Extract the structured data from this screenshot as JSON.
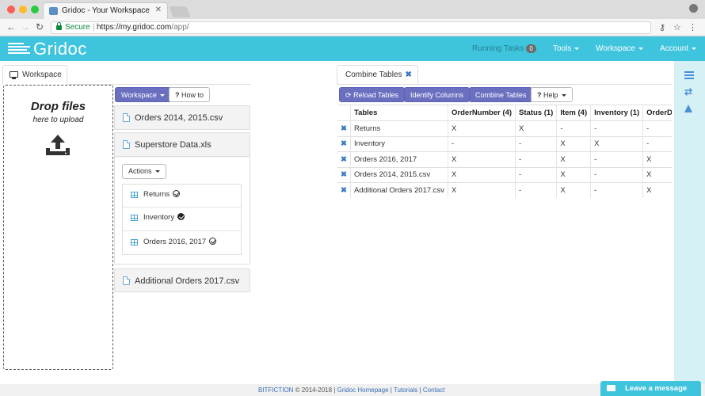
{
  "browser": {
    "tab_title": "Gridoc - Your Workspace",
    "secure_label": "Secure",
    "url_host": "https://my.gridoc.com",
    "url_path": "/app/"
  },
  "navbar": {
    "logo": "Gridoc",
    "running_tasks_label": "Running Tasks",
    "running_tasks_count": "0",
    "tools": "Tools",
    "workspace": "Workspace",
    "account": "Account",
    "color": "#3fc4de"
  },
  "left_panel": {
    "tab_label": "Workspace",
    "drop_title": "Drop files",
    "drop_subtitle": "here to upload",
    "workspace_button": "Workspace",
    "howto_button": "How to",
    "files": [
      {
        "name": "Orders 2014, 2015.csv"
      },
      {
        "name": "Superstore Data.xls"
      },
      {
        "name": "Additional Orders 2017.csv"
      }
    ],
    "actions_button": "Actions",
    "sheets": [
      {
        "label": "Returns",
        "icon": "check-circle-outline"
      },
      {
        "label": "Inventory",
        "icon": "check-circle-solid"
      },
      {
        "label": "Orders 2016, 2017",
        "icon": "check-circle-outline"
      }
    ]
  },
  "combine": {
    "tab_label": "Combine Tables",
    "reload_button": "Reload Tables",
    "identify_button": "Identify Columns",
    "combine_button": "Combine Tables",
    "help_button": "Help",
    "headers": [
      "Tables",
      "OrderNumber (4)",
      "Status (1)",
      "Item (4)",
      "Inventory (1)",
      "OrderD"
    ],
    "rows": [
      [
        "Returns",
        "X",
        "X",
        "-",
        "-",
        "-"
      ],
      [
        "Inventory",
        "-",
        "-",
        "X",
        "X",
        "-"
      ],
      [
        "Orders 2016, 2017",
        "X",
        "-",
        "X",
        "-",
        "X"
      ],
      [
        "Orders 2014, 2015.csv",
        "X",
        "-",
        "X",
        "-",
        "X"
      ],
      [
        "Additional Orders 2017.csv",
        "X",
        "-",
        "X",
        "-",
        "X"
      ]
    ],
    "remove_icon": "x-icon"
  },
  "footer": {
    "company": "BITFICTION",
    "copyright": "© 2014-2018 |",
    "homepage": "Gridoc Homepage",
    "sep1": "|",
    "tutorials": "Tutorials",
    "sep2": "|",
    "contact": "Contact",
    "leave_message": "Leave a message"
  }
}
